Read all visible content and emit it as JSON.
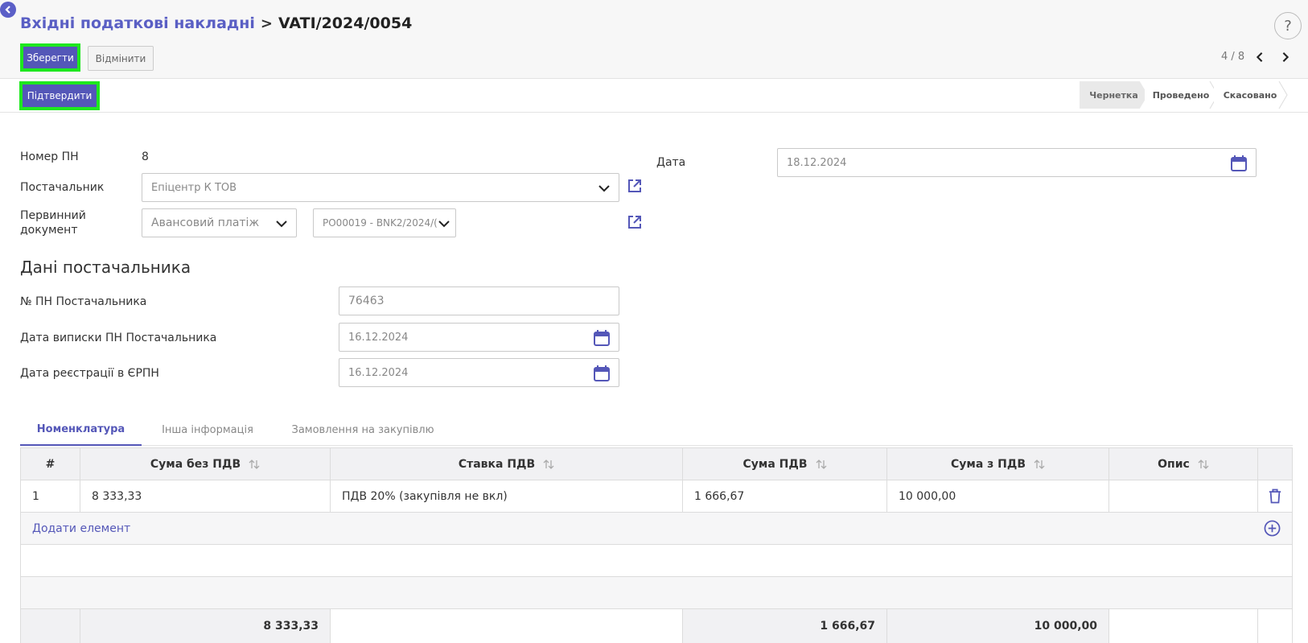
{
  "header": {
    "breadcrumb_parent": "Вхідні податкові накладні",
    "breadcrumb_separator": ">",
    "breadcrumb_current": "VATI/2024/0054",
    "help_label": "?"
  },
  "toolbar": {
    "save_label": "Зберегти",
    "cancel_label": "Відмінити",
    "pager_text": "4 / 8"
  },
  "statusbar": {
    "confirm_label": "Підтвердити",
    "stages": [
      "Чернетка",
      "Проведено",
      "Скасовано"
    ],
    "active_stage": "Чернетка"
  },
  "form": {
    "number_label": "Номер ПН",
    "number_value": "8",
    "supplier_label": "Постачальник",
    "supplier_value": "Епіцентр К ТОВ",
    "primary_doc_label_1": "Первинний",
    "primary_doc_label_2": "документ",
    "primary_doc_type": "Авансовий платіж",
    "primary_doc_ref": "PO00019 - BNK2/2024/(",
    "date_label": "Дата",
    "date_value": "18.12.2024"
  },
  "supplier_section": {
    "title": "Дані постачальника",
    "invoice_no_label": "№ ПН Постачальника",
    "invoice_no_value": "76463",
    "invoice_date_label": "Дата виписки ПН Постачальника",
    "invoice_date_value": "16.12.2024",
    "reg_date_label": "Дата реєстрації в ЄРПН",
    "reg_date_value": "16.12.2024"
  },
  "tabs": [
    "Номенклатура",
    "Інша інформація",
    "Замовлення на закупівлю"
  ],
  "table": {
    "columns": [
      "#",
      "Сума без ПДВ",
      "Ставка ПДВ",
      "Сума ПДВ",
      "Сума з ПДВ",
      "Опис"
    ],
    "rows": [
      [
        "1",
        "8 333,33",
        "ПДВ 20% (закупівля не вкл)",
        "1 666,67",
        "10 000,00",
        ""
      ]
    ],
    "add_label": "Додати елемент",
    "totals": [
      "",
      "8 333,33",
      "",
      "1 666,67",
      "10 000,00",
      ""
    ]
  },
  "colors": {
    "accent": "#5457b8",
    "highlight": "#1ee81e"
  },
  "icons": [
    "back-arrow-icon",
    "calendar-icon",
    "external-link-icon",
    "chevron-down-icon",
    "sort-icon",
    "trash-icon",
    "plus-circle-icon",
    "chevron-left-icon",
    "chevron-right-icon"
  ]
}
